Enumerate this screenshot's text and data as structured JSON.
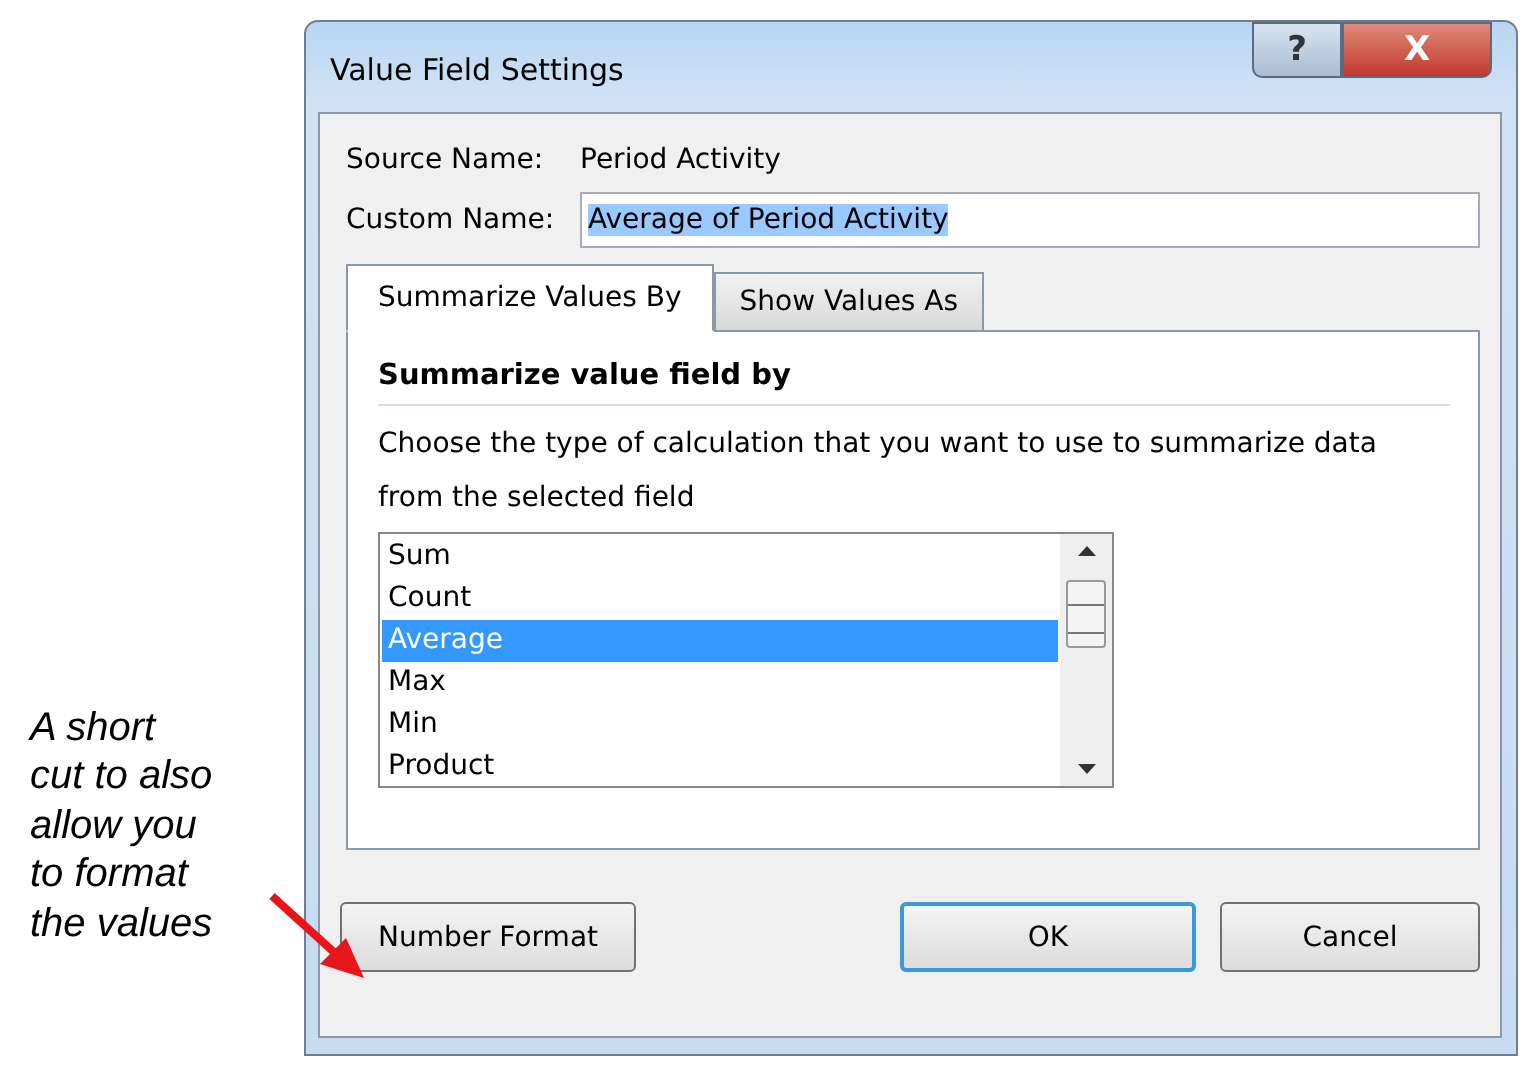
{
  "annotation": {
    "text": "A short\ncut to also\nallow you\nto format\nthe values"
  },
  "window": {
    "title": "Value Field Settings",
    "controls": [
      "?",
      "X"
    ]
  },
  "source_name": {
    "label": "Source Name:",
    "value": "Period Activity"
  },
  "custom_name": {
    "label": "Custom Name:",
    "value": "Average of Period Activity"
  },
  "tabs": [
    {
      "label": "Summarize Values By",
      "selected": true
    },
    {
      "label": "Show Values As",
      "selected": false
    }
  ],
  "section": {
    "heading": "Summarize value field by",
    "description": "Choose the type of calculation that you want to use to summarize data from the selected field"
  },
  "calculations": [
    {
      "label": "Sum",
      "selected": false
    },
    {
      "label": "Count",
      "selected": false
    },
    {
      "label": "Average",
      "selected": true
    },
    {
      "label": "Max",
      "selected": false
    },
    {
      "label": "Min",
      "selected": false
    },
    {
      "label": "Product",
      "selected": false
    }
  ],
  "buttons": [
    {
      "label": "Number Format",
      "kind": "plain"
    },
    {
      "label": "OK",
      "kind": "default"
    },
    {
      "label": "Cancel",
      "kind": "plain"
    }
  ]
}
